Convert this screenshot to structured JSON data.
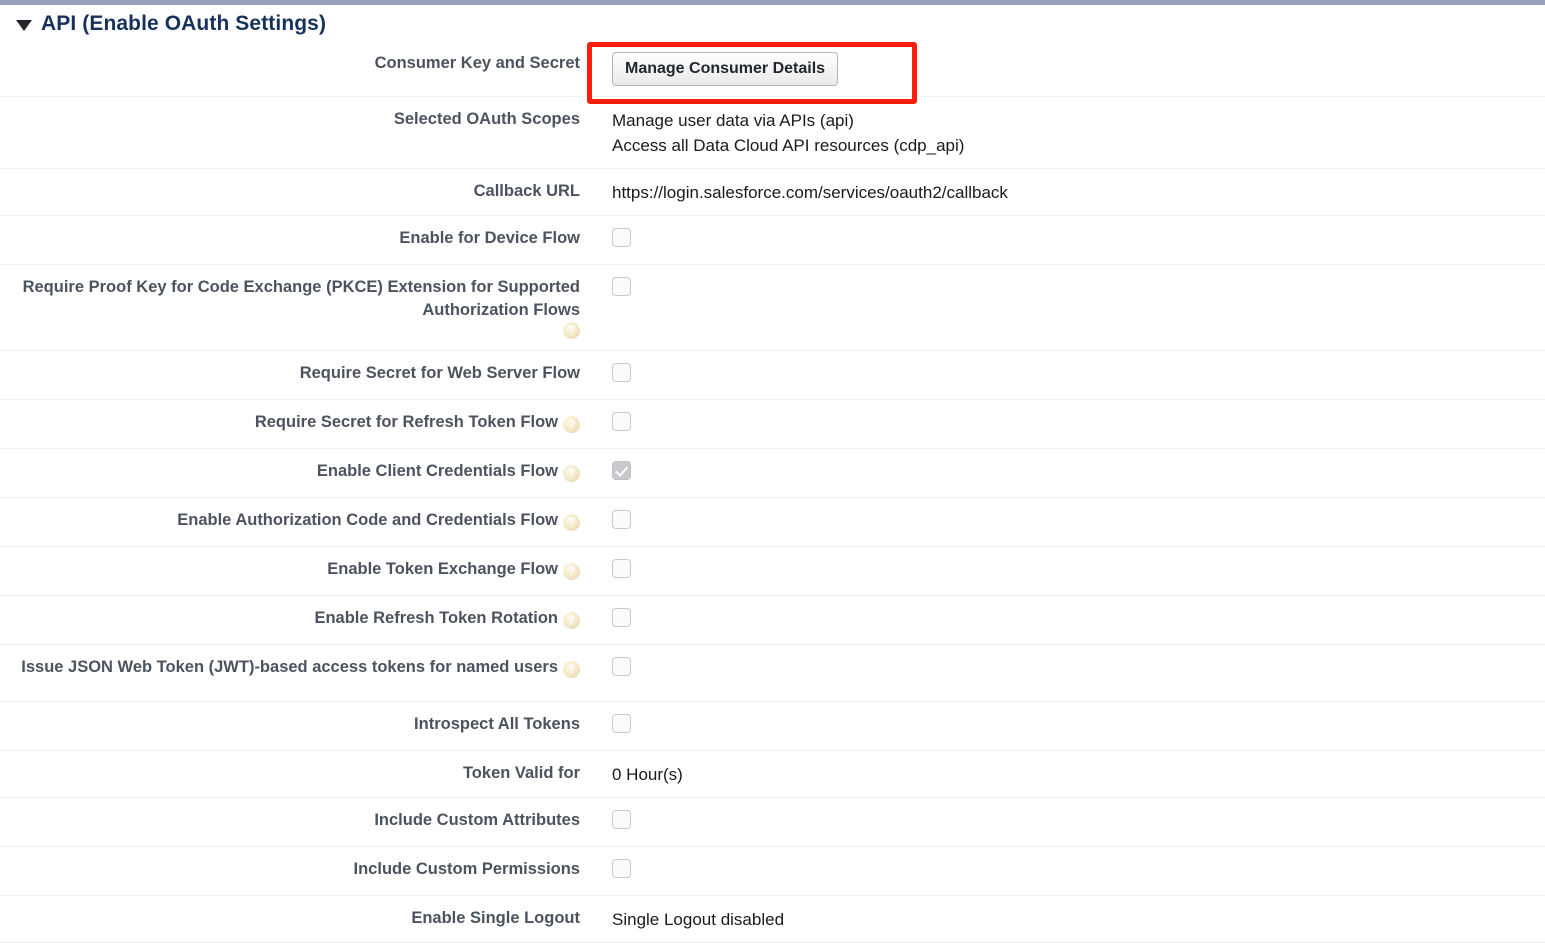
{
  "section": {
    "title": "API (Enable OAuth Settings)",
    "twisty_icon": "triangle-down-icon",
    "expanded": true
  },
  "colors": {
    "top_rule": "#9aa0bb",
    "label_text": "#4c535f",
    "section_title": "#16325c",
    "value_text": "#1a1a1a",
    "row_divider": "#eceef1",
    "highlight": "#fc1d0b",
    "help_icon": "#e8d6ab",
    "checkbox_border": "#c8c9ca",
    "checkbox_checked_fill": "#c7c9cc"
  },
  "annotation": {
    "type": "red-rectangle-highlight",
    "targets": "manage-consumer-details-button"
  },
  "rows": [
    {
      "label": "Consumer Key and Secret",
      "help": false,
      "type": "button",
      "button_label": "Manage Consumer Details",
      "highlighted": true
    },
    {
      "label": "Selected OAuth Scopes",
      "help": false,
      "type": "multiline-text",
      "lines": [
        "Manage user data via APIs (api)",
        "Access all Data Cloud API resources (cdp_api)"
      ]
    },
    {
      "label": "Callback URL",
      "help": false,
      "type": "text",
      "value": "https://login.salesforce.com/services/oauth2/callback"
    },
    {
      "label": "Enable for Device Flow",
      "help": false,
      "type": "checkbox",
      "checked": false
    },
    {
      "label": "Require Proof Key for Code Exchange (PKCE) Extension for Supported Authorization Flows",
      "help": true,
      "type": "checkbox",
      "checked": false,
      "two_line": true
    },
    {
      "label": "Require Secret for Web Server Flow",
      "help": false,
      "type": "checkbox",
      "checked": false
    },
    {
      "label": "Require Secret for Refresh Token Flow",
      "help": true,
      "type": "checkbox",
      "checked": false
    },
    {
      "label": "Enable Client Credentials Flow",
      "help": true,
      "type": "checkbox",
      "checked": true
    },
    {
      "label": "Enable Authorization Code and Credentials Flow",
      "help": true,
      "type": "checkbox",
      "checked": false
    },
    {
      "label": "Enable Token Exchange Flow",
      "help": true,
      "type": "checkbox",
      "checked": false
    },
    {
      "label": "Enable Refresh Token Rotation",
      "help": true,
      "type": "checkbox",
      "checked": false
    },
    {
      "label": "Issue JSON Web Token (JWT)-based access tokens for named users",
      "help": true,
      "type": "checkbox",
      "checked": false,
      "two_line": true
    },
    {
      "label": "Introspect All Tokens",
      "help": false,
      "type": "checkbox",
      "checked": false
    },
    {
      "label": "Token Valid for",
      "help": false,
      "type": "text",
      "value": "0 Hour(s)"
    },
    {
      "label": "Include Custom Attributes",
      "help": false,
      "type": "checkbox",
      "checked": false
    },
    {
      "label": "Include Custom Permissions",
      "help": false,
      "type": "checkbox",
      "checked": false
    },
    {
      "label": "Enable Single Logout",
      "help": false,
      "type": "text",
      "value": "Single Logout disabled"
    }
  ],
  "help_icon_glyph": "?"
}
